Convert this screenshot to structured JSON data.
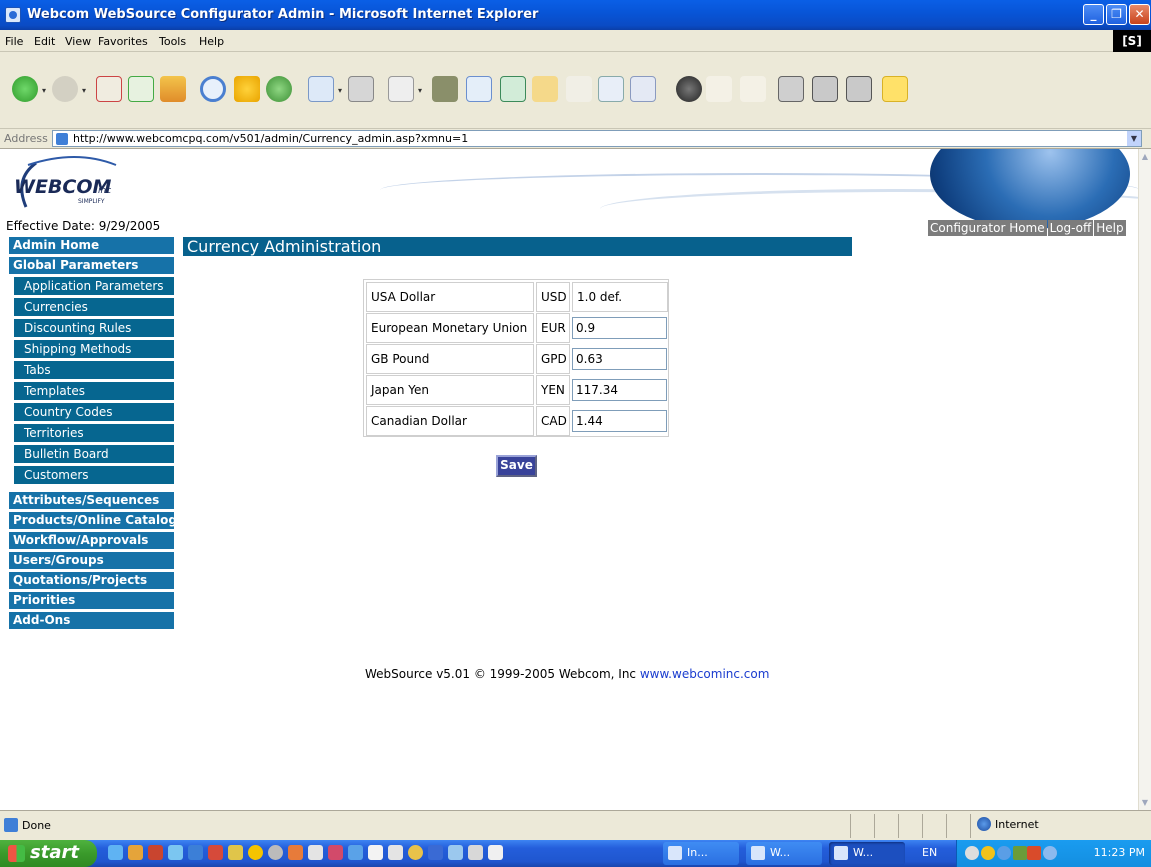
{
  "window": {
    "title": "Webcom WebSource Configurator Admin - Microsoft Internet Explorer"
  },
  "menu": {
    "items": [
      "File",
      "Edit",
      "View",
      "Favorites",
      "Tools",
      "Help"
    ],
    "badge": "[S]"
  },
  "address": {
    "label": "Address",
    "url": "http://www.webcomcpq.com/v501/admin/Currency_admin.asp?xmnu=1"
  },
  "banner": {
    "logo_text": "WEBCOM",
    "logo_suffix": "inc",
    "logo_tagline": "SIMPLIFY",
    "effective_date": "Effective Date: 9/29/2005"
  },
  "toplinks": [
    "Configurator Home",
    "Log-off",
    "Help"
  ],
  "sidebar": {
    "admin_home": "Admin Home",
    "global_parameters": "Global Parameters",
    "sub_items": [
      "Application Parameters",
      "Currencies",
      "Discounting Rules",
      "Shipping Methods",
      "Tabs",
      "Templates",
      "Country Codes",
      "Territories",
      "Bulletin Board",
      "Customers"
    ],
    "sections": [
      "Attributes/Sequences",
      "Products/Online Catalog",
      "Workflow/Approvals",
      "Users/Groups",
      "Quotations/Projects",
      "Priorities",
      "Add-Ons"
    ]
  },
  "page": {
    "title": "Currency Administration",
    "save_label": "Save"
  },
  "currencies": [
    {
      "name": "USA Dollar",
      "code": "USD",
      "rate": "1.0 def."
    },
    {
      "name": "European Monetary Union",
      "code": "EUR",
      "rate": "0.9"
    },
    {
      "name": "GB Pound",
      "code": "GPD",
      "rate": "0.63"
    },
    {
      "name": "Japan Yen",
      "code": "YEN",
      "rate": "117.34"
    },
    {
      "name": "Canadian Dollar",
      "code": "CAD",
      "rate": "1.44"
    }
  ],
  "footer": {
    "text": "WebSource v5.01 © 1999-2005 Webcom, Inc ",
    "link": "www.webcominc.com"
  },
  "status": {
    "text": "Done",
    "zone": "Internet"
  },
  "taskbar": {
    "start": "start",
    "tasks": [
      "In...",
      "W...",
      "W..."
    ],
    "lang": "EN",
    "clock": "11:23 PM"
  },
  "colors": {
    "header_blue": "#07618d",
    "sidebar_head": "#1672a8",
    "sidebar_sub": "#066690",
    "save_btn": "#39439a",
    "toplink_gray": "#7c7c7c"
  }
}
